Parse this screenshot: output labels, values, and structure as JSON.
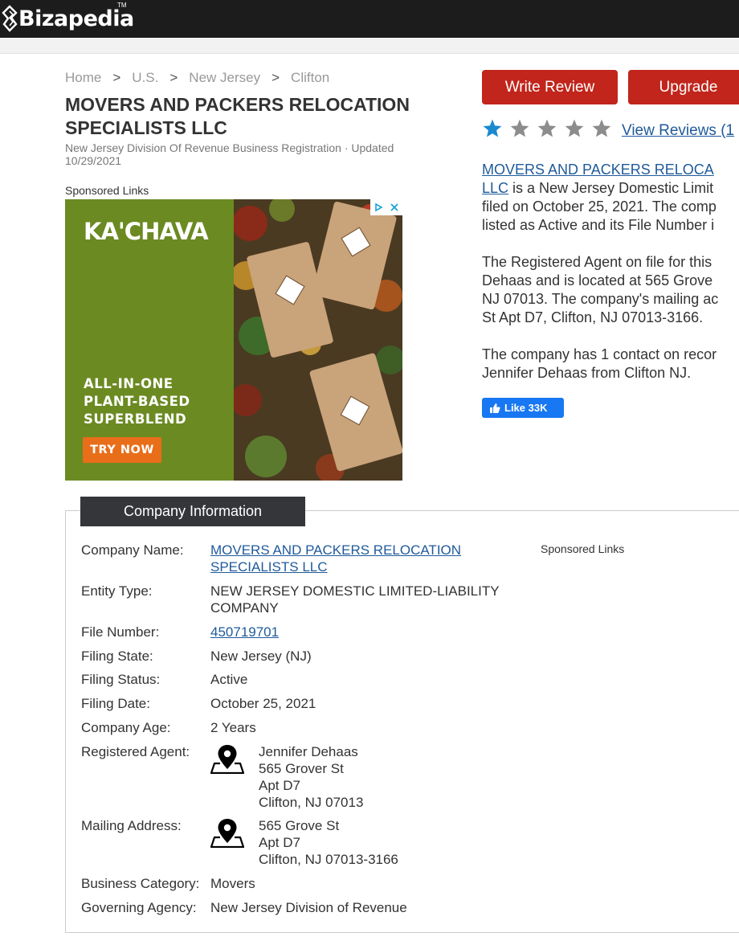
{
  "header": {
    "logo_text": "Bizapedia",
    "logo_tm": "TM"
  },
  "breadcrumb": [
    "Home",
    "U.S.",
    "New Jersey",
    "Clifton"
  ],
  "breadcrumb_separator": ">",
  "title_lines": [
    "MOVERS AND PACKERS RELOCATION",
    "SPECIALISTS LLC"
  ],
  "source_line": "New Jersey Division Of Revenue Business Registration · Updated 10/29/2021",
  "sponsored_label": "Sponsored Links",
  "ad": {
    "brand": "KA'CHAVA",
    "tagline": "ALL-IN-ONE PLANT-BASED SUPERBLEND",
    "cta": "TRY NOW",
    "colors": {
      "panel": "#6b8a22",
      "cta": "#e86e1a"
    }
  },
  "actions": {
    "write_review": "Write Review",
    "upgrade": "Upgrade"
  },
  "rating": {
    "stars_filled": 1,
    "stars_total": 5,
    "view_reviews": "View Reviews (1"
  },
  "description": {
    "p1_link_lines": [
      "MOVERS AND PACKERS RELOCA",
      "LLC"
    ],
    "p1_text_after_link": " is a New Jersey Domestic Limit",
    "p1_lines": [
      "filed on October 25, 2021. The comp",
      "listed as Active and its File Number i"
    ],
    "p2_lines": [
      "The Registered Agent on file for this",
      "Dehaas and is located at 565 Grove",
      "NJ 07013. The company's mailing ac",
      "St Apt D7, Clifton, NJ 07013-3166."
    ],
    "p3_lines": [
      "The company has 1 contact on recor",
      "Jennifer Dehaas from Clifton NJ."
    ]
  },
  "like": {
    "label": "Like 33K"
  },
  "company_info": {
    "tab_label": "Company Information",
    "company_name_label": "Company Name:",
    "company_name_lines": [
      "MOVERS AND PACKERS RELOCATION",
      "SPECIALISTS LLC"
    ],
    "entity_type_label": "Entity Type:",
    "entity_type_lines": [
      "NEW JERSEY DOMESTIC LIMITED-LIABILITY",
      "COMPANY"
    ],
    "file_number_label": "File Number:",
    "file_number": "450719701",
    "filing_state_label": "Filing State:",
    "filing_state": "New Jersey (NJ)",
    "filing_status_label": "Filing Status:",
    "filing_status": "Active",
    "filing_date_label": "Filing Date:",
    "filing_date": "October 25, 2021",
    "company_age_label": "Company Age:",
    "company_age": "2 Years",
    "registered_agent_label": "Registered Agent:",
    "registered_agent_lines": [
      "Jennifer Dehaas",
      "565 Grover St",
      "Apt D7",
      "Clifton, NJ 07013"
    ],
    "mailing_address_label": "Mailing Address:",
    "mailing_address_lines": [
      "565 Grove St",
      "Apt D7",
      "Clifton, NJ 07013-3166"
    ],
    "business_category_label": "Business Category:",
    "business_category": "Movers",
    "governing_agency_label": "Governing Agency:",
    "governing_agency": "New Jersey Division of Revenue"
  },
  "colors": {
    "topbar": "#1c1c1c",
    "button_red": "#c1251b",
    "link_blue": "#1f5a9a",
    "star_blue": "#1a8ad0",
    "star_grey": "#8c8c8c",
    "tab_dark": "#35363a",
    "facebook_blue": "#1877f2"
  }
}
